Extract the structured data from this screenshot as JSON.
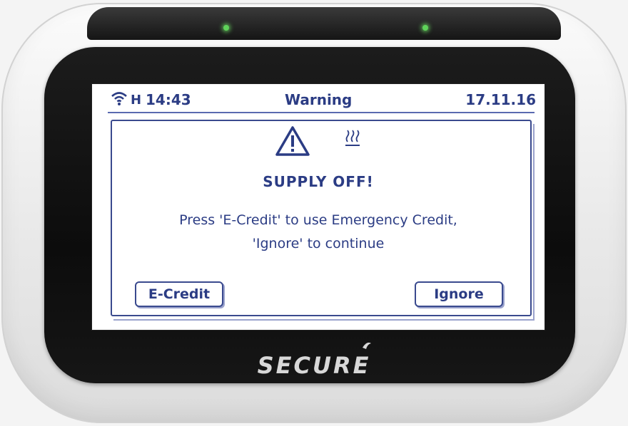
{
  "status_bar": {
    "signal_type": "H",
    "time": "14:43",
    "title": "Warning",
    "date": "17.11.16"
  },
  "dialog": {
    "heading": "SUPPLY OFF!",
    "message_line1": "Press 'E-Credit' to use Emergency Credit,",
    "message_line2": "'Ignore' to continue",
    "ecredit_label": "E-Credit",
    "ignore_label": "Ignore"
  },
  "device": {
    "brand": "SECURE"
  },
  "icons": {
    "signal": "wifi-icon",
    "warning": "warning-triangle-icon",
    "supply": "heat-icon"
  },
  "colors": {
    "screen_text": "#2b3c84",
    "led": "#5fd35a"
  }
}
